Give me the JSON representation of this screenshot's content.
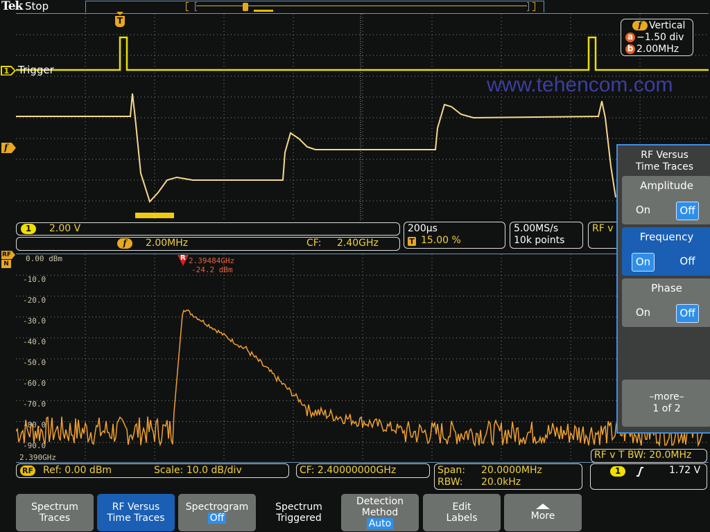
{
  "header": {
    "brand": "Tek",
    "run_status": "Stop"
  },
  "time_domain": {
    "ch1_marker": "1",
    "ch1_label": "Trigger",
    "trigger_pos_label": "T",
    "math_marker": "f",
    "watermark": "www.tehencom.com",
    "vertical_box": {
      "title_icon": "f",
      "title": "Vertical",
      "a_icon": "a",
      "a_value": "−1.50 div",
      "b_icon": "b",
      "b_value": "2.00MHz"
    }
  },
  "readouts": {
    "ch1": {
      "icon": "1",
      "scale": "2.00 V"
    },
    "math": {
      "icon": "f",
      "scale": "2.00MHz",
      "cf_label": "CF:",
      "cf_value": "2.40GHz"
    },
    "horizontal": {
      "scale": "200µs",
      "trigger_icon": "T",
      "trigger_pos": "15.00 %"
    },
    "acquisition": {
      "sample_rate": "5.00MS/s",
      "record_length": "10k points"
    },
    "rf_v_t_partial": "RF v",
    "rf_vt_bw": "RF v T BW: 20.0MHz",
    "rf": {
      "icon": "RF",
      "ref": "Ref: 0.00 dBm",
      "scale": "Scale: 10.0 dB/div"
    },
    "cf": "CF:  2.40000000GHz",
    "span_label": "Span:",
    "span_value": "20.0000MHz",
    "rbw_label": "RBW:",
    "rbw_value": "20.0kHz",
    "trigger": {
      "icon": "1",
      "slope": "rising",
      "level": "1.72 V"
    }
  },
  "spectrum": {
    "rf_marker_top": "RF",
    "rf_marker_bottom": "N",
    "start_freq": "2.390GHz",
    "ref_marker": {
      "icon": "R",
      "freq": "2.39484GHz",
      "level": "-24.2 dBm"
    },
    "y_labels": [
      "0.00 dBm",
      "-10.0",
      "-20.0",
      "-30.0",
      "-40.0",
      "-50.0",
      "-60.0",
      "-70.0",
      "-80.0",
      "-90.0"
    ]
  },
  "side_menu": {
    "title_line1": "RF Versus",
    "title_line2": "Time Traces",
    "amplitude": {
      "label": "Amplitude",
      "on": "On",
      "off": "Off",
      "selected": "Off"
    },
    "frequency": {
      "label": "Frequency",
      "on": "On",
      "off": "Off",
      "selected": "On"
    },
    "phase": {
      "label": "Phase",
      "on": "On",
      "off": "Off",
      "selected": "Off"
    },
    "more_line1": "–more–",
    "more_line2": "1 of 2"
  },
  "bottom_menu": {
    "spectrum_traces_1": "Spectrum",
    "spectrum_traces_2": "Traces",
    "rf_vs_time_1": "RF Versus",
    "rf_vs_time_2": "Time Traces",
    "spectrogram_1": "Spectrogram",
    "spectrogram_2": "Off",
    "spectrum_triggered_1": "Spectrum",
    "spectrum_triggered_2": "Triggered",
    "detection_1": "Detection",
    "detection_2": "Method",
    "detection_3": "Auto",
    "edit_labels_1": "Edit",
    "edit_labels_2": "Labels",
    "more": "More"
  },
  "colors": {
    "ch1": "#e8e000",
    "math": "#f6d98a",
    "rf": "#f0a030",
    "ref_marker": "#e02020",
    "menu_active": "#1a5fb4",
    "menu_selected": "#2f8fe8"
  }
}
